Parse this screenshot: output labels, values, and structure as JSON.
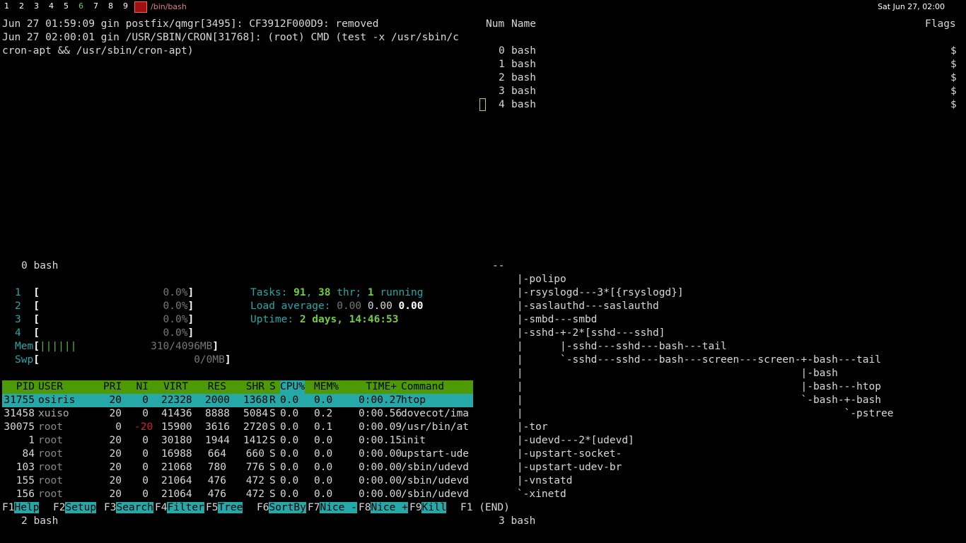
{
  "topbar": {
    "workspaces": [
      "1",
      "2",
      "3",
      "4",
      "5",
      "6",
      "7",
      "8",
      "9"
    ],
    "active_workspace": "6",
    "window_title": "/bin/bash",
    "clock": "Sat Jun 27, 02:00",
    "icon": "terminal-app-icon"
  },
  "pane_log": {
    "lines": [
      "Jun 27 01:59:09 gin postfix/qmgr[3495]: CF3912F000D9: removed",
      "Jun 27 02:00:01 gin /USR/SBIN/CRON[31768]: (root) CMD (test -x /usr/sbin/c",
      "cron-apt && /usr/sbin/cron-apt)"
    ],
    "status": "0 bash"
  },
  "pane_windowlist": {
    "header_num": "Num",
    "header_name": "Name",
    "header_flags": "Flags",
    "windows": [
      {
        "num": "0",
        "name": "bash",
        "flag": "$"
      },
      {
        "num": "1",
        "name": "bash",
        "flag": "$"
      },
      {
        "num": "2",
        "name": "bash",
        "flag": "$"
      },
      {
        "num": "3",
        "name": "bash",
        "flag": "$"
      },
      {
        "num": "4",
        "name": "bash",
        "flag": "$"
      }
    ]
  },
  "htop": {
    "cpus": [
      {
        "id": "1",
        "pct": "0.0%"
      },
      {
        "id": "2",
        "pct": "0.0%"
      },
      {
        "id": "3",
        "pct": "0.0%"
      },
      {
        "id": "4",
        "pct": "0.0%"
      }
    ],
    "mem": {
      "label": "Mem",
      "bars": "||||||",
      "value": "310/4096MB"
    },
    "swp": {
      "label": "Swp",
      "value": "0/0MB"
    },
    "tasks_label": "Tasks: ",
    "tasks": "91",
    "thr": "38",
    "thr_label": " thr; ",
    "running": "1",
    "running_label": " running",
    "load_label": "Load average: ",
    "load1": "0.00",
    "load5": "0.00",
    "load15": "0.00",
    "uptime_label": "Uptime: ",
    "uptime": "2 days, 14:46:53",
    "columns": [
      "PID",
      "USER",
      "PRI",
      "NI",
      "VIRT",
      "RES",
      "SHR",
      "S",
      "CPU%",
      "MEM%",
      "TIME+",
      "Command"
    ],
    "processes": [
      {
        "pid": "31755",
        "user": "osiris",
        "pri": "20",
        "ni": "0",
        "virt": "22328",
        "res": "2000",
        "shr": "1368",
        "s": "R",
        "cpu": "0.0",
        "mem": "0.0",
        "time": "0:00.27",
        "cmd": "htop"
      },
      {
        "pid": "31458",
        "user": "xuiso",
        "pri": "20",
        "ni": "0",
        "virt": "41436",
        "res": "8888",
        "shr": "5084",
        "s": "S",
        "cpu": "0.0",
        "mem": "0.2",
        "time": "0:00.56",
        "cmd": "dovecot/ima"
      },
      {
        "pid": "30075",
        "user": "root",
        "pri": "0",
        "ni": "-20",
        "virt": "15900",
        "res": "3616",
        "shr": "2720",
        "s": "S",
        "cpu": "0.0",
        "mem": "0.1",
        "time": "0:00.09",
        "cmd": "/usr/bin/at"
      },
      {
        "pid": "1",
        "user": "root",
        "pri": "20",
        "ni": "0",
        "virt": "30180",
        "res": "1944",
        "shr": "1412",
        "s": "S",
        "cpu": "0.0",
        "mem": "0.0",
        "time": "0:00.15",
        "cmd": "init"
      },
      {
        "pid": "84",
        "user": "root",
        "pri": "20",
        "ni": "0",
        "virt": "16988",
        "res": "664",
        "shr": "660",
        "s": "S",
        "cpu": "0.0",
        "mem": "0.0",
        "time": "0:00.00",
        "cmd": "upstart-ude"
      },
      {
        "pid": "103",
        "user": "root",
        "pri": "20",
        "ni": "0",
        "virt": "21068",
        "res": "780",
        "shr": "776",
        "s": "S",
        "cpu": "0.0",
        "mem": "0.0",
        "time": "0:00.00",
        "cmd": "/sbin/udevd"
      },
      {
        "pid": "155",
        "user": "root",
        "pri": "20",
        "ni": "0",
        "virt": "21064",
        "res": "476",
        "shr": "472",
        "s": "S",
        "cpu": "0.0",
        "mem": "0.0",
        "time": "0:00.00",
        "cmd": "/sbin/udevd"
      },
      {
        "pid": "156",
        "user": "root",
        "pri": "20",
        "ni": "0",
        "virt": "21064",
        "res": "476",
        "shr": "472",
        "s": "S",
        "cpu": "0.0",
        "mem": "0.0",
        "time": "0:00.00",
        "cmd": "/sbin/udevd"
      }
    ],
    "fkeys": [
      {
        "key": "F1",
        "label": "Help  "
      },
      {
        "key": "F2",
        "label": "Setup "
      },
      {
        "key": "F3",
        "label": "Search"
      },
      {
        "key": "F4",
        "label": "Filter"
      },
      {
        "key": "F5",
        "label": "Tree  "
      },
      {
        "key": "F6",
        "label": "SortBy"
      },
      {
        "key": "F7",
        "label": "Nice -"
      },
      {
        "key": "F8",
        "label": "Nice +"
      },
      {
        "key": "F9",
        "label": "Kill  "
      }
    ],
    "status": "2 bash"
  },
  "pane_pstree": {
    "lines": [
      "--",
      "    |-polipo",
      "    |-rsyslogd---3*[{rsyslogd}]",
      "    |-saslauthd---saslauthd",
      "    |-smbd---smbd",
      "    |-sshd-+-2*[sshd---sshd]",
      "    |      |-sshd---sshd---bash---tail",
      "    |      `-sshd---sshd---bash---screen---screen-+-bash---tail",
      "    |                                             |-bash",
      "    |                                             |-bash---htop",
      "    |                                             `-bash-+-bash",
      "    |                                                    `-pstree",
      "    |-tor",
      "    |-udevd---2*[udevd]",
      "    |-upstart-socket-",
      "    |-upstart-udev-br",
      "    |-vnstatd",
      "    `-xinetd"
    ],
    "footer": "F1 (END)",
    "status": "3 bash"
  },
  "colors": {
    "accent_cyan": "#24a8a8",
    "header_green": "#4e9a06",
    "red": "#d82020"
  }
}
